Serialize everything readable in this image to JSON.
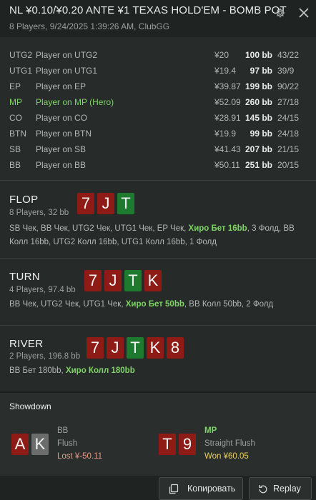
{
  "header": {
    "title": "NL ¥0.10/¥0.20 ANTE ¥1 TEXAS HOLD'EM - BOMB POT",
    "subtitle": "8 Players, 9/24/2025 1:39:26 AM, ClubGG"
  },
  "players": [
    {
      "pos": "UTG2",
      "name": "Player on UTG2",
      "stack": "¥20",
      "bb": "100 bb",
      "vpip": "43/22"
    },
    {
      "pos": "UTG1",
      "name": "Player on UTG1",
      "stack": "¥19.4",
      "bb": "97 bb",
      "vpip": "39/9"
    },
    {
      "pos": "EP",
      "name": "Player on EP",
      "stack": "¥39.87",
      "bb": "199 bb",
      "vpip": "90/22"
    },
    {
      "pos": "MP",
      "name": "Player on MP (Hero)",
      "stack": "¥52.09",
      "bb": "260 bb",
      "vpip": "27/18"
    },
    {
      "pos": "CO",
      "name": "Player on CO",
      "stack": "¥28.91",
      "bb": "145 bb",
      "vpip": "24/15"
    },
    {
      "pos": "BTN",
      "name": "Player on BTN",
      "stack": "¥19.9",
      "bb": "99 bb",
      "vpip": "24/18"
    },
    {
      "pos": "SB",
      "name": "Player on SB",
      "stack": "¥41.43",
      "bb": "207 bb",
      "vpip": "21/15"
    },
    {
      "pos": "BB",
      "name": "Player on BB",
      "stack": "¥50.11",
      "bb": "251 bb",
      "vpip": "20/15"
    }
  ],
  "flop": {
    "name": "FLOP",
    "info": "8 Players, 32 bb",
    "cards": [
      "7",
      "J",
      "T"
    ],
    "actions_pre": "SB Чек, BB Чек, UTG2 Чек, UTG1 Чек, EP Чек, ",
    "actions_hero": "Хиро Бет 16bb",
    "actions_post": ", 3 Фолд, BB Колл 16bb, UTG2 Колл 16bb, UTG1 Колл 16bb, 1 Фолд"
  },
  "turn": {
    "name": "TURN",
    "info": "4 Players, 97.4 bb",
    "cards": [
      "7",
      "J",
      "T",
      "K"
    ],
    "actions_pre": "BB Чек, UTG2 Чек, UTG1 Чек, ",
    "actions_hero": "Хиро Бет 50bb",
    "actions_post": ", BB Колл 50bb, 2 Фолд"
  },
  "river": {
    "name": "RIVER",
    "info": "2 Players, 196.8 bb",
    "cards": [
      "7",
      "J",
      "T",
      "K",
      "8"
    ],
    "actions_pre": "BB Бет 180bb, ",
    "actions_hero": "Хиро Колл 180bb",
    "actions_post": ""
  },
  "showdown": {
    "title": "Showdown",
    "players": [
      {
        "pos": "BB",
        "cards": [
          "A",
          "K"
        ],
        "hand": "Flush",
        "result": "Lost ¥-50.11"
      },
      {
        "pos": "MP",
        "cards": [
          "T",
          "9"
        ],
        "hand": "Straight Flush",
        "result": "Won ¥60.05"
      }
    ]
  },
  "footer": {
    "copy_label": "Копировать",
    "replay_label": "Replay"
  },
  "colors": {
    "hero_green": "#7fd467",
    "card_red": "#8e1b15",
    "card_green": "#1d7a2f",
    "card_grey": "#6a6d6c",
    "won": "#e9cf64",
    "lost": "#e39b8b"
  },
  "icons": [
    "gear-icon",
    "close-icon",
    "copy-icon",
    "replay-icon"
  ]
}
